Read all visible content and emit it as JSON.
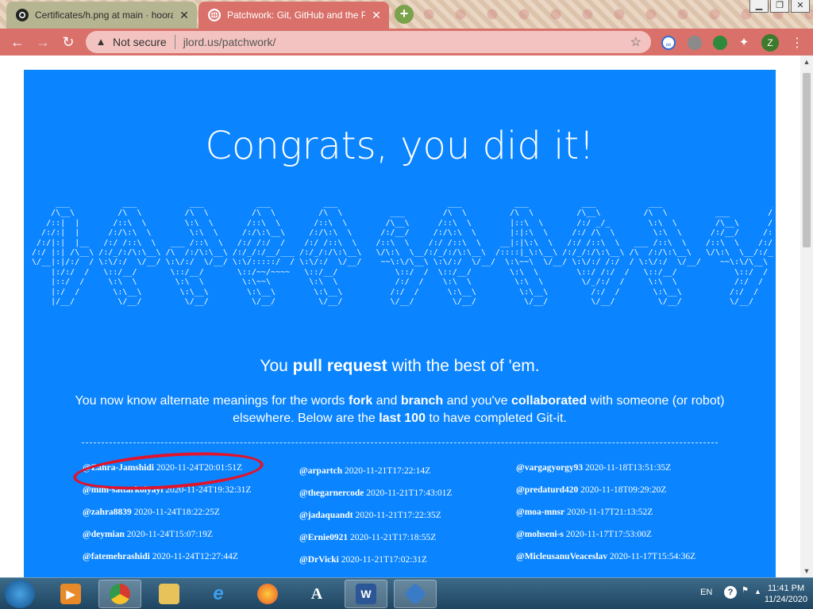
{
  "browser": {
    "tabs": [
      {
        "title": "Certificates/h.png at main · hoora",
        "favicon": "github-icon"
      },
      {
        "title": "Patchwork: Git, GitHub and the P",
        "favicon": "globe-icon"
      }
    ],
    "new_tab_label": "+",
    "address": {
      "security": "Not secure",
      "url": "jlord.us/patchwork/"
    },
    "profile_initial": "Z"
  },
  "page": {
    "title": "Congrats, you did it!",
    "ascii_art": "      ___           ___           ___           ___           ___                       ___           ___           ___           ___                       ___           ___     \n     /\\__\\         /\\  \\         /\\  \\         /\\  \\         /\\  \\          ___        /\\  \\         /\\  \\         /\\__\\         /\\  \\          ___        /\\  \\         /\\  \\    \n    /::|  |       /::\\  \\        \\:\\  \\       /::\\  \\       /::\\  \\        /\\__\\      /::\\  \\        |::\\  \\       /:/ _/_        \\:\\  \\        /\\__\\      /::\\  \\        \\:\\  \\   \n   /:/:|  |      /:/\\:\\  \\        \\:\\  \\     /:/\\:\\__\\     /:/\\:\\  \\      /:/__/     /:/\\:\\  \\       |:|:\\  \\     /:/ /\\  \\        \\:\\  \\      /:/__/     /:/\\:\\  \\        \\:\\  \\  \n  /:/|:|  |__   /:/ /::\\  \\   ___ /::\\  \\   /:/ /:/  /    /:/ /::\\  \\    /::\\  \\    /:/ /::\\  \\    __|:|\\:\\  \\   /:/ /::\\  \\   ___ /::\\  \\    /::\\  \\    /:/  \\:\\  \\   ___ /::\\  \\ \n /:/ |:| /\\__\\ /:/_/:/\\:\\__\\ /\\  /:/\\:\\__\\ /:/_/:/__/___ /:/_/:/\\:\\__\\   \\/\\:\\  \\__/:/_/:/\\:\\__\\  /::::|_\\:\\__\\ /:/_/:/\\:\\__\\ /\\  /:/\\:\\__\\   \\/\\:\\  \\__/:/__/ \\:\\__\\ /\\  /:/\\:\\__\\\n \\/__|:|/:/  / \\:\\/:/  \\/__/ \\:\\/:/  \\/__/ \\:\\/:::::/  / \\:\\/:/  \\/__/    ~~\\:\\/\\__\\ \\:\\/:/  \\/__/  \\:\\~~\\  \\/__/ \\:\\/:/ /:/  / \\:\\/:/  \\/__/    ~~\\:\\/\\__\\ \\:\\  \\ /:/  / \\:\\/:/  \\/__/\n     |:/:/  /   \\::/__/       \\::/__/       \\::/~~/~~~~   \\::/__/            \\::/  /  \\::/__/        \\:\\  \\        \\::/ /:/  /   \\::/__/            \\::/  /  \\:\\  /:/  /   \\::/__/     \n     |::/  /     \\:\\  \\        \\:\\  \\        \\:\\~~\\        \\:\\  \\            /:/  /    \\:\\  \\         \\:\\  \\        \\/_/:/  /     \\:\\  \\            /:/  /    \\:\\/:/  /     \\:\\  \\     \n     |:/  /       \\:\\__\\        \\:\\__\\        \\:\\__\\        \\:\\__\\          /:/  /      \\:\\__\\         \\:\\__\\         /:/  /       \\:\\__\\          /:/  /      \\::/  /       \\:\\__\\    \n     |/__/         \\/__/         \\/__/         \\/__/         \\/__/          \\/__/        \\/__/          \\/__/         \\/__/         \\/__/          \\/__/        \\/__/         \\/__/    ",
    "tagline_pre": "You ",
    "tagline_bold": "pull request",
    "tagline_post": " with the best of 'em.",
    "desc": {
      "t1": "You now know alternate meanings for the words ",
      "b1": "fork",
      "t2": " and ",
      "b2": "branch",
      "t3": " and you've ",
      "b3": "collaborated",
      "t4": " with someone (or robot) elsewhere. Below are the ",
      "b4": "last 100",
      "t5": " to have completed Git-it."
    },
    "completions": [
      [
        {
          "user": "@Zahra-Jamshidi",
          "time": "2020-11-24T20:01:51Z"
        },
        {
          "user": "@mim-sattarkolyayi",
          "time": "2020-11-24T19:32:31Z"
        },
        {
          "user": "@zahra8839",
          "time": "2020-11-24T18:22:25Z"
        },
        {
          "user": "@deymian",
          "time": "2020-11-24T15:07:19Z"
        },
        {
          "user": "@fatemehrashidi",
          "time": "2020-11-24T12:27:44Z"
        }
      ],
      [
        {
          "user": "@arpartch",
          "time": "2020-11-21T17:22:14Z"
        },
        {
          "user": "@thegarnercode",
          "time": "2020-11-21T17:43:01Z"
        },
        {
          "user": "@jadaquandt",
          "time": "2020-11-21T17:22:35Z"
        },
        {
          "user": "@Ernie0921",
          "time": "2020-11-21T17:18:55Z"
        },
        {
          "user": "@DrVicki",
          "time": "2020-11-21T17:02:31Z"
        }
      ],
      [
        {
          "user": "@vargagyorgy93",
          "time": "2020-11-18T13:51:35Z"
        },
        {
          "user": "@predaturd420",
          "time": "2020-11-18T09:29:20Z"
        },
        {
          "user": "@moa-mnsr",
          "time": "2020-11-17T21:13:52Z"
        },
        {
          "user": "@mohseni-s",
          "time": "2020-11-17T17:53:00Z"
        },
        {
          "user": "@MicleusanuVeaceslav",
          "time": "2020-11-17T15:54:36Z"
        }
      ]
    ]
  },
  "taskbar": {
    "apps": [
      "windows-explorer",
      "video-player",
      "chrome",
      "file-explorer",
      "internet-explorer",
      "firefox",
      "font-viewer",
      "word",
      "git-client"
    ],
    "lang": "EN",
    "time": "11:41 PM",
    "date": "11/24/2020"
  },
  "colors": {
    "page_bg": "#0a84ff",
    "browser_accent": "#d9706a",
    "highlight": "#e0142a"
  }
}
